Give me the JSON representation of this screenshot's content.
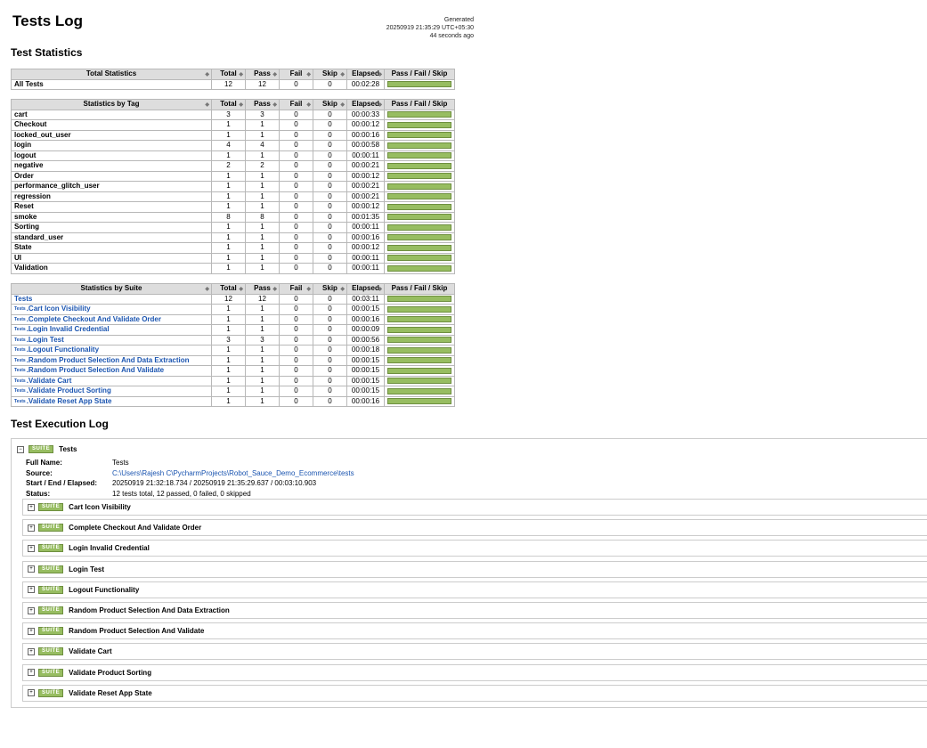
{
  "header": {
    "title": "Tests Log",
    "generated_label": "Generated",
    "generated_time": "20250919 21:35:29 UTC+05:30",
    "generated_ago": "44 seconds ago"
  },
  "sections": {
    "test_statistics": "Test Statistics",
    "execution_log": "Test Execution Log"
  },
  "columns": [
    "Total",
    "Pass",
    "Fail",
    "Skip",
    "Elapsed",
    "Pass / Fail / Skip"
  ],
  "total_stats": {
    "header": "Total Statistics",
    "rows": [
      {
        "name": "All Tests",
        "total": "12",
        "pass": "12",
        "fail": "0",
        "skip": "0",
        "elapsed": "00:02:28",
        "pass_ratio": 1.0
      }
    ]
  },
  "tag_stats": {
    "header": "Statistics by Tag",
    "rows": [
      {
        "name": "cart",
        "total": "3",
        "pass": "3",
        "fail": "0",
        "skip": "0",
        "elapsed": "00:00:33",
        "pass_ratio": 1.0
      },
      {
        "name": "Checkout",
        "total": "1",
        "pass": "1",
        "fail": "0",
        "skip": "0",
        "elapsed": "00:00:12",
        "pass_ratio": 1.0
      },
      {
        "name": "locked_out_user",
        "total": "1",
        "pass": "1",
        "fail": "0",
        "skip": "0",
        "elapsed": "00:00:16",
        "pass_ratio": 1.0
      },
      {
        "name": "login",
        "total": "4",
        "pass": "4",
        "fail": "0",
        "skip": "0",
        "elapsed": "00:00:58",
        "pass_ratio": 1.0
      },
      {
        "name": "logout",
        "total": "1",
        "pass": "1",
        "fail": "0",
        "skip": "0",
        "elapsed": "00:00:11",
        "pass_ratio": 1.0
      },
      {
        "name": "negative",
        "total": "2",
        "pass": "2",
        "fail": "0",
        "skip": "0",
        "elapsed": "00:00:21",
        "pass_ratio": 1.0
      },
      {
        "name": "Order",
        "total": "1",
        "pass": "1",
        "fail": "0",
        "skip": "0",
        "elapsed": "00:00:12",
        "pass_ratio": 1.0
      },
      {
        "name": "performance_glitch_user",
        "total": "1",
        "pass": "1",
        "fail": "0",
        "skip": "0",
        "elapsed": "00:00:21",
        "pass_ratio": 1.0
      },
      {
        "name": "regression",
        "total": "1",
        "pass": "1",
        "fail": "0",
        "skip": "0",
        "elapsed": "00:00:21",
        "pass_ratio": 1.0
      },
      {
        "name": "Reset",
        "total": "1",
        "pass": "1",
        "fail": "0",
        "skip": "0",
        "elapsed": "00:00:12",
        "pass_ratio": 1.0
      },
      {
        "name": "smoke",
        "total": "8",
        "pass": "8",
        "fail": "0",
        "skip": "0",
        "elapsed": "00:01:35",
        "pass_ratio": 1.0
      },
      {
        "name": "Sorting",
        "total": "1",
        "pass": "1",
        "fail": "0",
        "skip": "0",
        "elapsed": "00:00:11",
        "pass_ratio": 1.0
      },
      {
        "name": "standard_user",
        "total": "1",
        "pass": "1",
        "fail": "0",
        "skip": "0",
        "elapsed": "00:00:16",
        "pass_ratio": 1.0
      },
      {
        "name": "State",
        "total": "1",
        "pass": "1",
        "fail": "0",
        "skip": "0",
        "elapsed": "00:00:12",
        "pass_ratio": 1.0
      },
      {
        "name": "UI",
        "total": "1",
        "pass": "1",
        "fail": "0",
        "skip": "0",
        "elapsed": "00:00:11",
        "pass_ratio": 1.0
      },
      {
        "name": "Validation",
        "total": "1",
        "pass": "1",
        "fail": "0",
        "skip": "0",
        "elapsed": "00:00:11",
        "pass_ratio": 1.0
      }
    ]
  },
  "suite_stats": {
    "header": "Statistics by Suite",
    "prefix": "Tests",
    "rows": [
      {
        "name": "Tests",
        "prefixed": false,
        "total": "12",
        "pass": "12",
        "fail": "0",
        "skip": "0",
        "elapsed": "00:03:11",
        "pass_ratio": 1.0
      },
      {
        "name": ".Cart Icon Visibility",
        "prefixed": true,
        "total": "1",
        "pass": "1",
        "fail": "0",
        "skip": "0",
        "elapsed": "00:00:15",
        "pass_ratio": 1.0
      },
      {
        "name": ".Complete Checkout And Validate Order",
        "prefixed": true,
        "total": "1",
        "pass": "1",
        "fail": "0",
        "skip": "0",
        "elapsed": "00:00:16",
        "pass_ratio": 1.0
      },
      {
        "name": ".Login Invalid Credential",
        "prefixed": true,
        "total": "1",
        "pass": "1",
        "fail": "0",
        "skip": "0",
        "elapsed": "00:00:09",
        "pass_ratio": 1.0
      },
      {
        "name": ".Login Test",
        "prefixed": true,
        "total": "3",
        "pass": "3",
        "fail": "0",
        "skip": "0",
        "elapsed": "00:00:56",
        "pass_ratio": 1.0
      },
      {
        "name": ".Logout Functionality",
        "prefixed": true,
        "total": "1",
        "pass": "1",
        "fail": "0",
        "skip": "0",
        "elapsed": "00:00:18",
        "pass_ratio": 1.0
      },
      {
        "name": ".Random Product Selection And Data Extraction",
        "prefixed": true,
        "total": "1",
        "pass": "1",
        "fail": "0",
        "skip": "0",
        "elapsed": "00:00:15",
        "pass_ratio": 1.0
      },
      {
        "name": ".Random Product Selection And Validate",
        "prefixed": true,
        "total": "1",
        "pass": "1",
        "fail": "0",
        "skip": "0",
        "elapsed": "00:00:15",
        "pass_ratio": 1.0
      },
      {
        "name": ".Validate Cart",
        "prefixed": true,
        "total": "1",
        "pass": "1",
        "fail": "0",
        "skip": "0",
        "elapsed": "00:00:15",
        "pass_ratio": 1.0
      },
      {
        "name": ".Validate Product Sorting",
        "prefixed": true,
        "total": "1",
        "pass": "1",
        "fail": "0",
        "skip": "0",
        "elapsed": "00:00:15",
        "pass_ratio": 1.0
      },
      {
        "name": ".Validate Reset App State",
        "prefixed": true,
        "total": "1",
        "pass": "1",
        "fail": "0",
        "skip": "0",
        "elapsed": "00:00:16",
        "pass_ratio": 1.0
      }
    ]
  },
  "execution": {
    "label": "SUITE",
    "collapse_symbol": "−",
    "expand_symbol": "+",
    "suite_name": "Tests",
    "meta": {
      "full_name_label": "Full Name:",
      "full_name": "Tests",
      "source_label": "Source:",
      "source": "C:\\Users\\Rajesh C\\PycharmProjects\\Robot_Sauce_Demo_Ecommerce\\tests",
      "times_label": "Start / End / Elapsed:",
      "times": "20250919 21:32:18.734 / 20250919 21:35:29.637 / 00:03:10.903",
      "status_label": "Status:",
      "status": "12 tests total, 12 passed, 0 failed, 0 skipped"
    },
    "children": [
      "Cart Icon Visibility",
      "Complete Checkout And Validate Order",
      "Login Invalid Credential",
      "Login Test",
      "Logout Functionality",
      "Random Product Selection And Data Extraction",
      "Random Product Selection And Validate",
      "Validate Cart",
      "Validate Product Sorting",
      "Validate Reset App State"
    ]
  },
  "colors": {
    "pass": "#97bd61",
    "link": "#1a54b0",
    "header_bg": "#dddddd"
  }
}
